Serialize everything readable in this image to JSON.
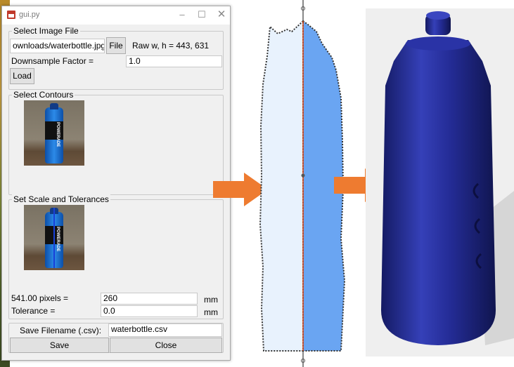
{
  "window": {
    "title": "gui.py",
    "minimize": "–",
    "maximize": "☐",
    "close": "✕"
  },
  "select_image": {
    "frame_label": "Select Image File",
    "path_value": "ownloads/waterbottle.jpg",
    "file_button": "File",
    "raw_info": "Raw w, h = 443, 631",
    "downsample_label": "Downsample Factor =",
    "downsample_value": "1.0",
    "load_button": "Load"
  },
  "select_contours": {
    "frame_label": "Select Contours",
    "thumb_text": "POWERADE"
  },
  "scale": {
    "frame_label": "Set Scale and Tolerances",
    "thumb_text": "POWERADE",
    "pixels_label": "541.00 pixels =",
    "pixels_value": "260",
    "pixels_unit": "mm",
    "tolerance_label": "Tolerance =",
    "tolerance_value": "0.0",
    "tolerance_unit": "mm"
  },
  "save": {
    "filename_label": "Save Filename (.csv):",
    "filename_value": "waterbottle.csv",
    "save_button": "Save",
    "close_button": "Close"
  },
  "colors": {
    "arrow": "#ee7b30",
    "contour_fill": "#6aa5f2",
    "contour_light": "#e6f1fc",
    "model": "#22288a"
  }
}
